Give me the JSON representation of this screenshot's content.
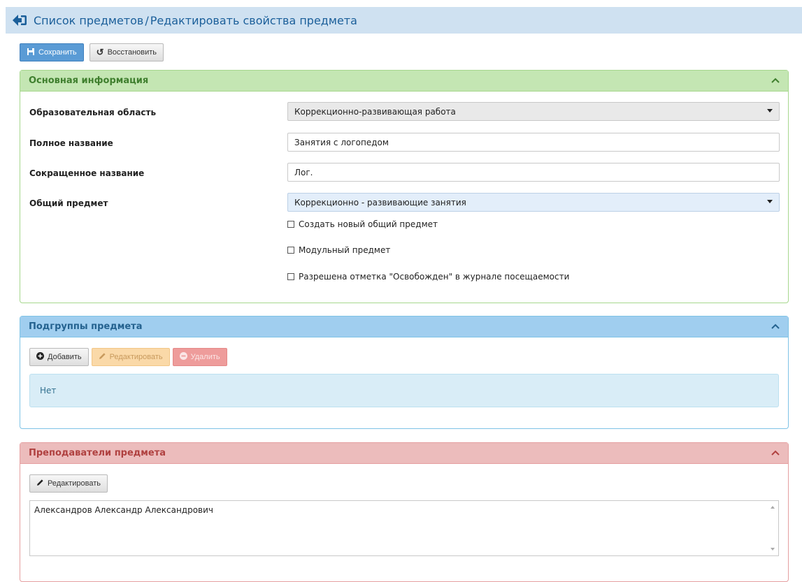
{
  "header": {
    "breadcrumb_list": "Список предметов",
    "separator": "/",
    "breadcrumb_current": "Редактировать свойства предмета",
    "back_icon": "arrow-left-circle-icon"
  },
  "toolbar": {
    "save_label": "Сохранить",
    "restore_label": "Восстановить"
  },
  "main_info": {
    "title": "Основная информация",
    "fields": [
      {
        "label": "Образовательная область",
        "value": "Коррекционно-развивающая работа"
      },
      {
        "label": "Полное название",
        "value": "Занятия с логопедом"
      },
      {
        "label": "Сокращенное название",
        "value": "Лог."
      },
      {
        "label": "Общий предмет",
        "value": "Коррекционно - развивающие занятия"
      }
    ],
    "checkboxes": [
      {
        "label": "Создать новый общий предмет",
        "checked": false
      },
      {
        "label": "Модульный предмет",
        "checked": false
      },
      {
        "label": "Разрешена отметка \"Освобожден\" в журнале посещаемости",
        "checked": false
      }
    ]
  },
  "subgroups": {
    "title": "Подгруппы предмета",
    "add_label": "Добавить",
    "edit_label": "Редактировать",
    "delete_label": "Удалить",
    "empty_text": "Нет"
  },
  "teachers": {
    "title": "Преподаватели предмета",
    "edit_label": "Редактировать",
    "list_text": "Александров Александр Александрович"
  },
  "colors": {
    "green_header": "#c4e6b3",
    "blue_header": "#a0ceef",
    "red_header": "#ecbcbc",
    "primary_button": "#5a9bd5"
  }
}
